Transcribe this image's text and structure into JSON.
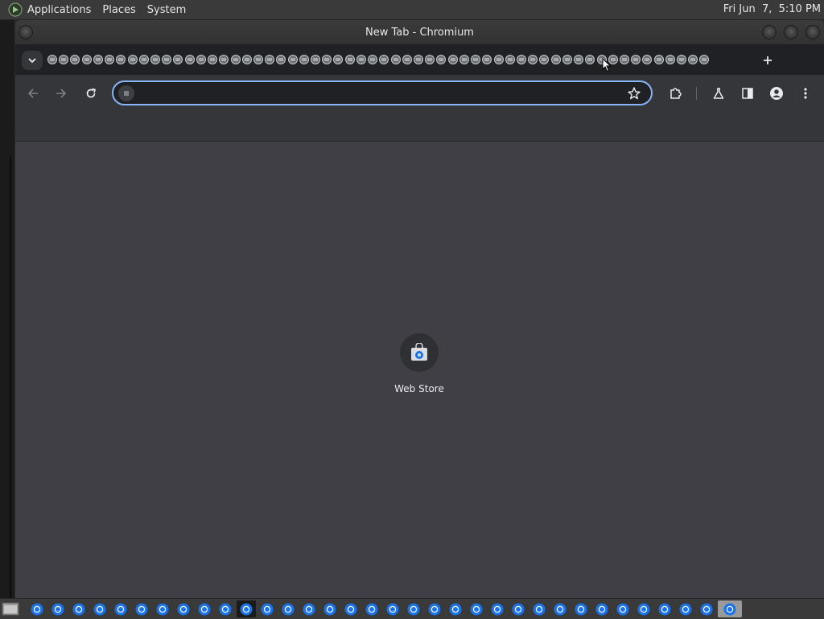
{
  "top_panel": {
    "menus": [
      "Applications",
      "Places",
      "System"
    ],
    "clock": "Fri Jun  7,  5:10 PM"
  },
  "window": {
    "title": "New Tab - Chromium",
    "tab_count": 58
  },
  "toolbar": {
    "omnibox_value": ""
  },
  "shortcuts": [
    {
      "label": "Web Store",
      "icon": "web-store-icon"
    }
  ],
  "taskbar": {
    "task_count": 34
  },
  "colors": {
    "accent": "#8ab4f8",
    "chrome_blue": "#1a73e8",
    "page_bg": "#3f3f45",
    "toolbar_bg": "#35363a"
  }
}
